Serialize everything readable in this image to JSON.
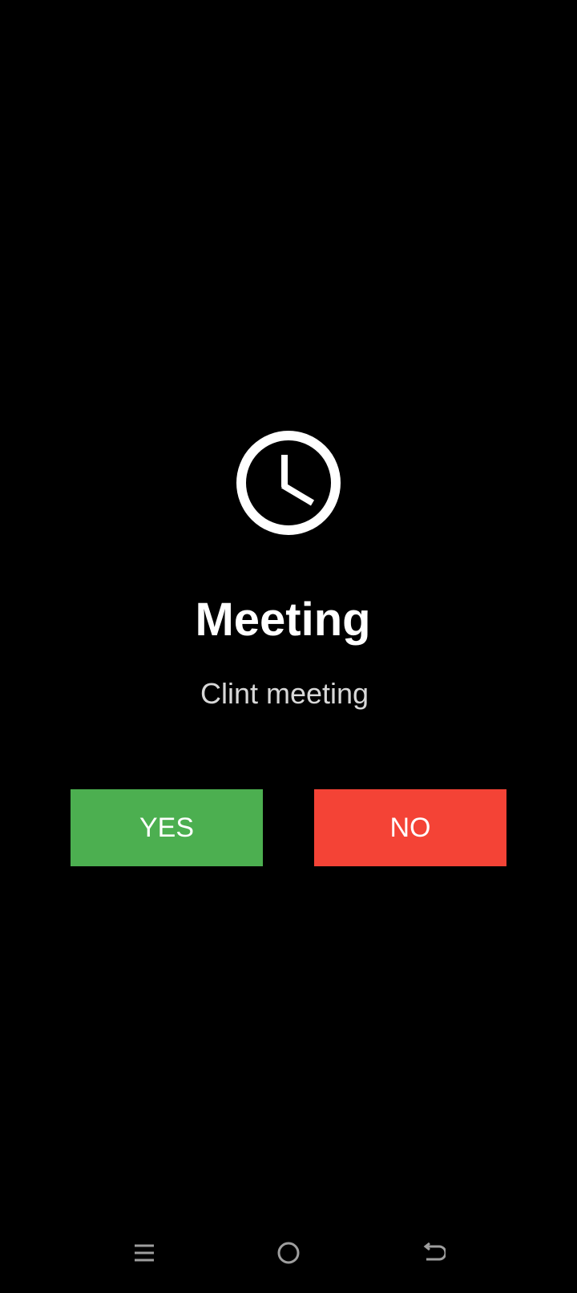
{
  "alarm": {
    "icon": "clock-icon",
    "title": "Meeting",
    "subtitle": "Clint meeting"
  },
  "buttons": {
    "yes_label": "YES",
    "no_label": "NO",
    "yes_color": "#4caf50",
    "no_color": "#f44336"
  },
  "navbar": {
    "items": [
      {
        "icon": "menu-icon"
      },
      {
        "icon": "home-icon"
      },
      {
        "icon": "back-icon"
      }
    ],
    "icon_color": "#9e9e9e"
  },
  "theme": {
    "background": "#000000",
    "text": "#ffffff",
    "subtext": "#d8d8d8"
  }
}
